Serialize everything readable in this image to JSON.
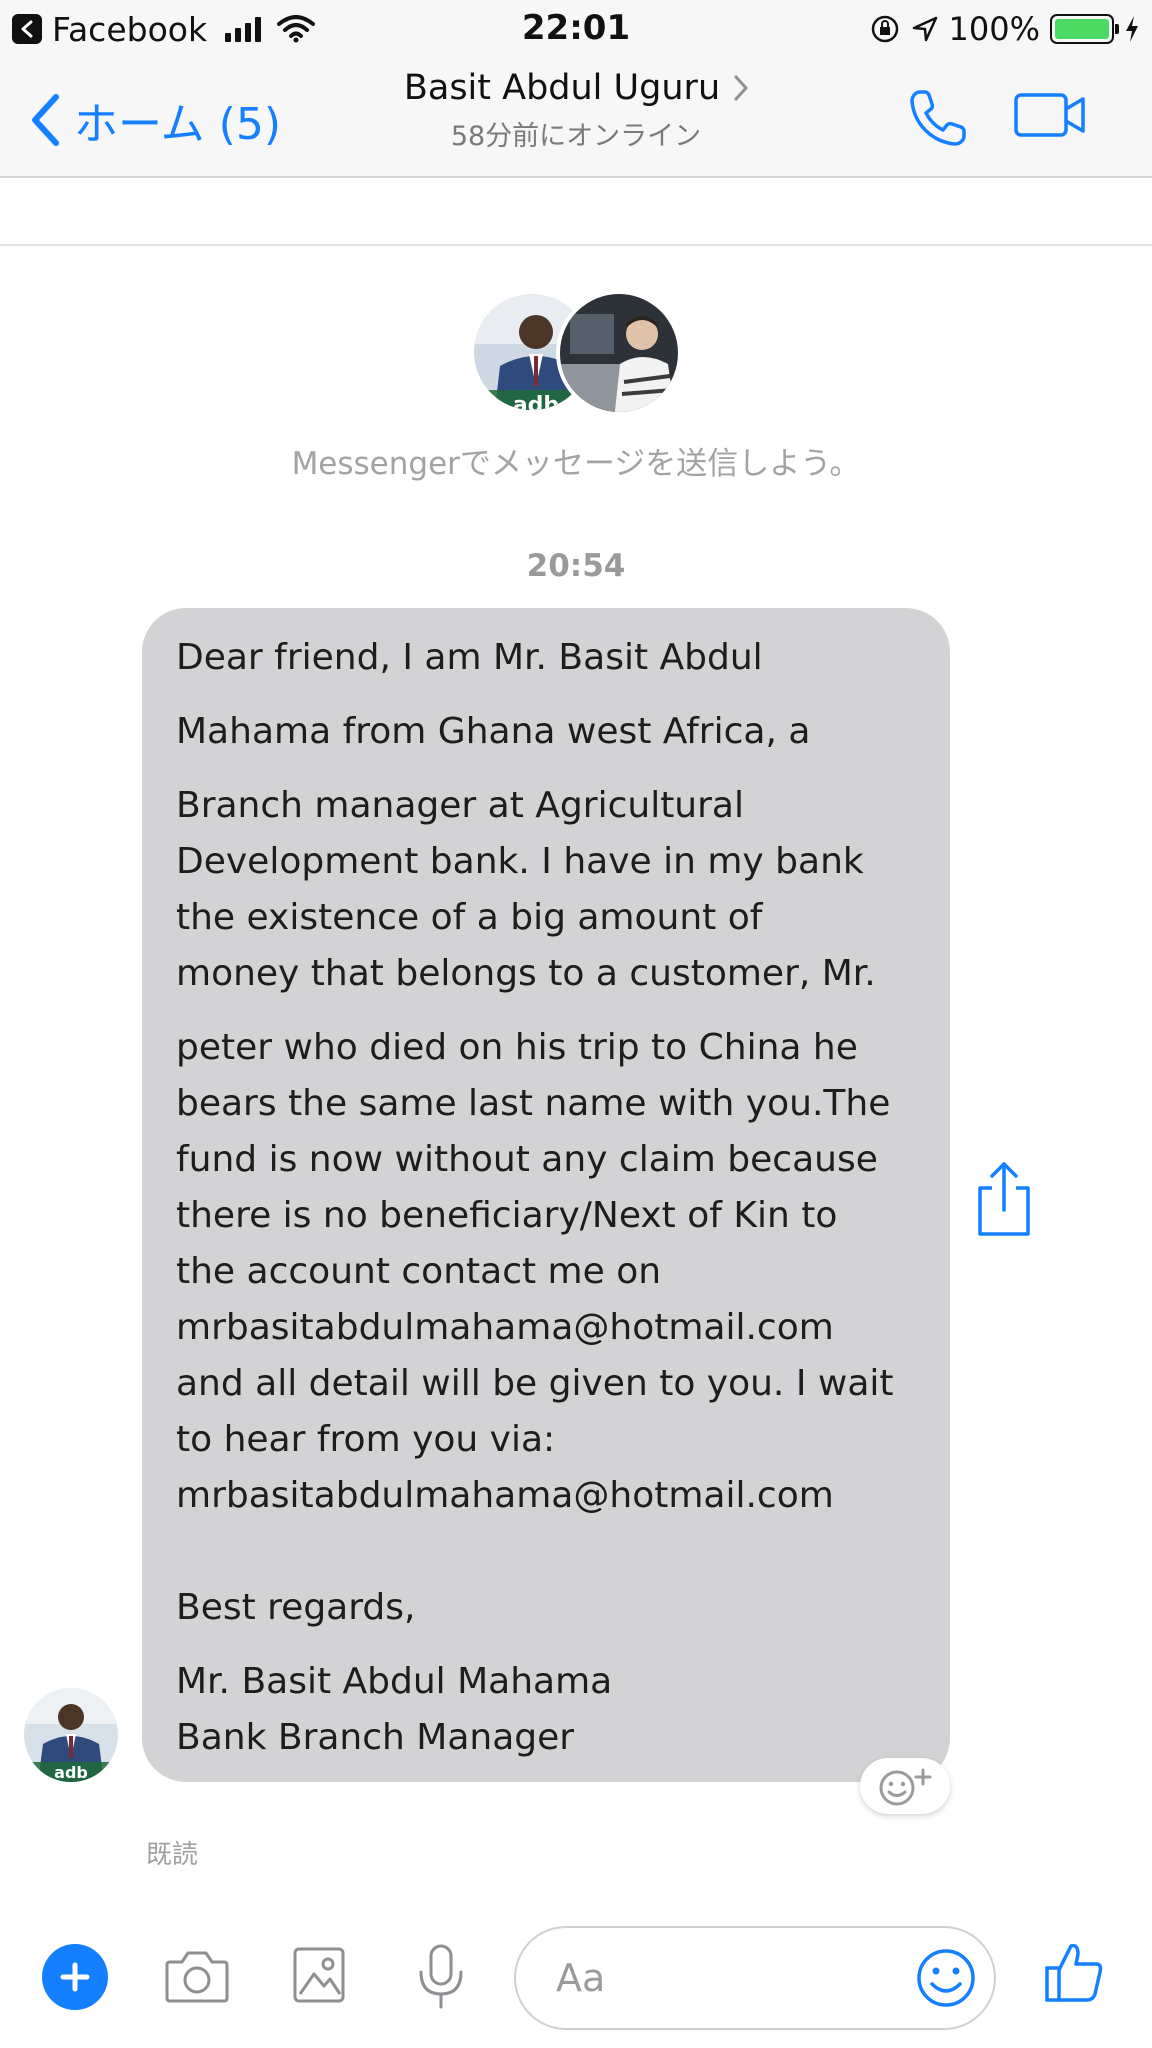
{
  "status_bar": {
    "app_name": "Facebook",
    "time": "22:01",
    "battery_percent_text": "100%",
    "battery_level": 1.0,
    "battery_color": "#4cd964"
  },
  "header": {
    "back_label": "ホーム (5)",
    "contact_name": "Basit Abdul Uguru",
    "online_status": "58分前にオンライン",
    "accent_color": "#1480ff",
    "icons": [
      "chevron-left-icon",
      "chevron-right-icon",
      "phone-icon",
      "video-camera-icon"
    ]
  },
  "intro": {
    "prompt": "Messengerでメッセージを送信しよう。"
  },
  "conversation": {
    "timestamp": "20:54",
    "message": {
      "paragraphs": [
        "Dear friend, I am Mr. Basit Abdul",
        "Mahama from Ghana west Africa, a",
        "Branch manager at Agricultural\nDevelopment bank. I have in my bank\nthe existence of a big amount of\nmoney that belongs to a customer, Mr.",
        "peter who died on his trip to China he\nbears the same last name with you.The\nfund is now without any claim because\nthere is no beneficiary/Next of Kin to\nthe account contact me on\nmrbasitabdulmahama@hotmail.com\nand all detail will be given to you. I wait\nto hear from you via:\nmrbasitabdulmahama@hotmail.com\n\nBest regards,",
        "Mr. Basit Abdul Mahama\nBank Branch Manager"
      ]
    },
    "read_receipt": "既読"
  },
  "composer": {
    "placeholder": "Aa",
    "icons": [
      "plus-icon",
      "camera-icon",
      "image-icon",
      "microphone-icon",
      "emoji-icon",
      "thumbs-up-icon"
    ]
  }
}
